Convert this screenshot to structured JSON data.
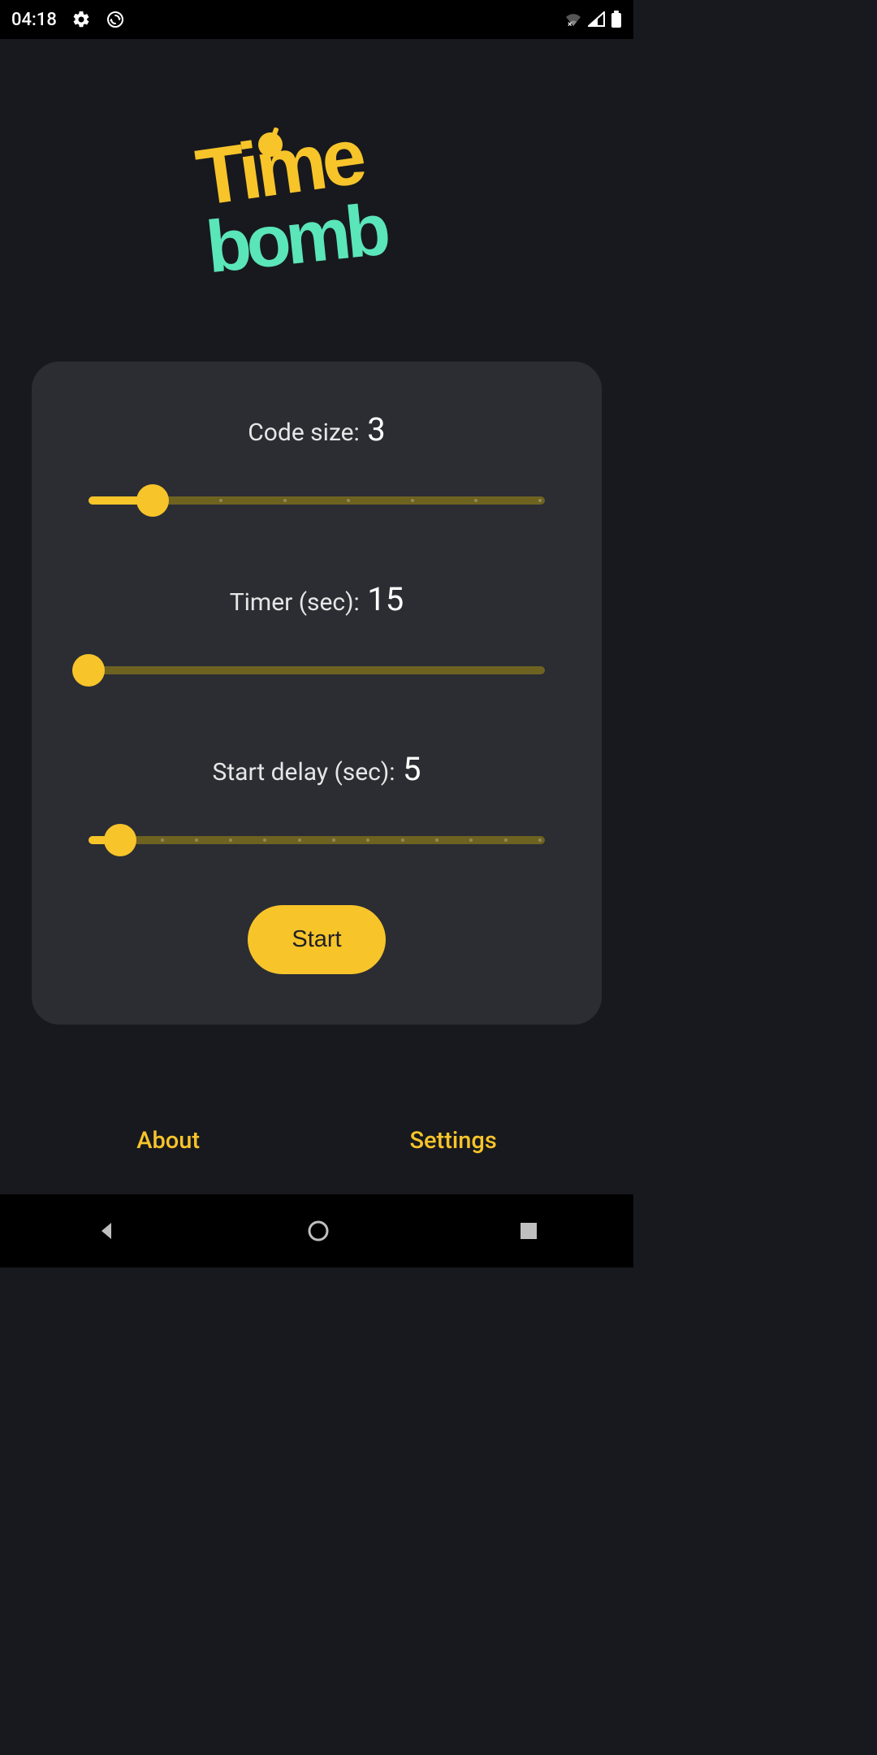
{
  "status_bar": {
    "time": "04:18"
  },
  "logo": {
    "line1": "Time",
    "line2": "bomb"
  },
  "controls": {
    "code_size": {
      "label": "Code size: ",
      "value": "3",
      "min": 2,
      "max": 9,
      "ticks": 8,
      "percent": 14
    },
    "timer": {
      "label": "Timer (sec): ",
      "value": "15",
      "min": 15,
      "max": 300,
      "ticks": 0,
      "percent": 0
    },
    "start_delay": {
      "label": "Start delay (sec): ",
      "value": "5",
      "min": 3,
      "max": 30,
      "ticks": 14,
      "percent": 7
    }
  },
  "buttons": {
    "start": "Start"
  },
  "footer": {
    "about": "About",
    "settings": "Settings"
  }
}
